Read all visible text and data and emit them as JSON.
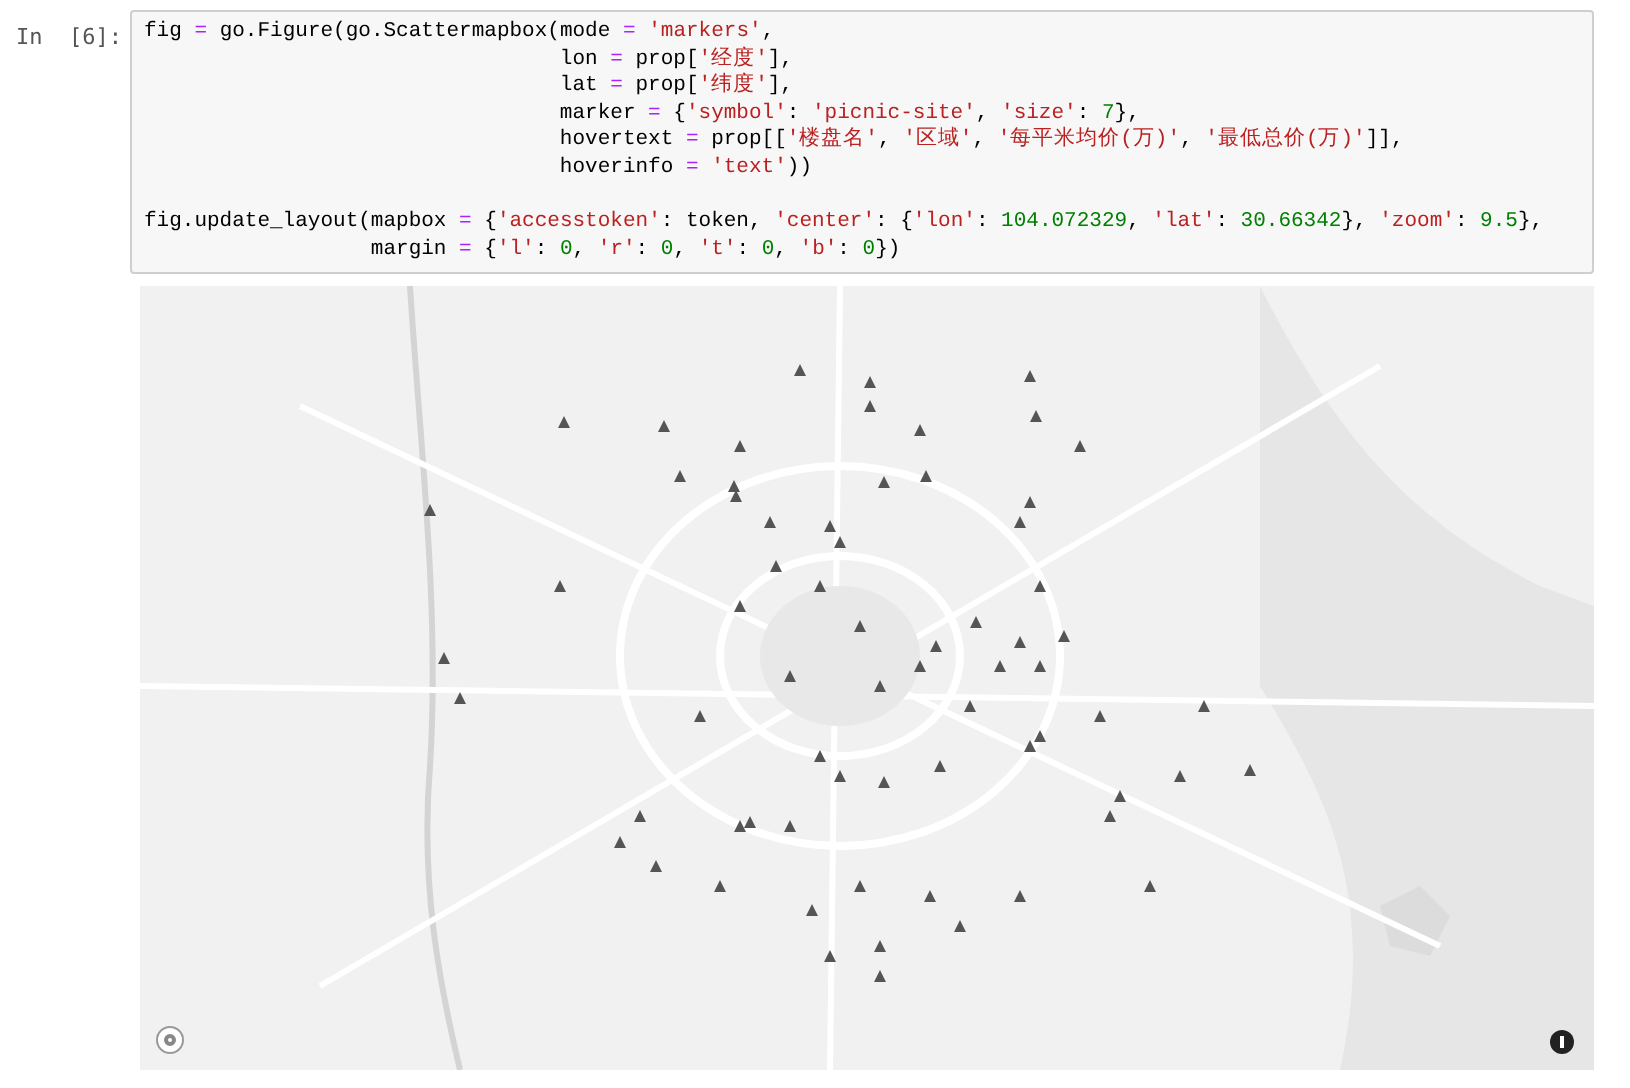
{
  "cell": {
    "prompt": "In  [6]:",
    "blocks": [
      [
        "fig = go.Figure(go.Scattermapbox(mode = 'markers',",
        "                                 lon = prop['经度'],",
        "                                 lat = prop['纬度'],",
        "                                 marker = {'symbol': 'picnic-site', 'size': 7},",
        "                                 hovertext = prop[['楼盘名', '区域', '每平米均价(万)', '最低总价(万)']],",
        "                                 hoverinfo = 'text'))"
      ],
      [
        "fig.update_layout(mapbox = {'accesstoken': token, 'center': {'lon': 104.072329, 'lat': 30.66342}, 'zoom': 9.5},",
        "                  margin = {'l': 0, 'r': 0, 't': 0, 'b': 0})"
      ]
    ]
  }
}
